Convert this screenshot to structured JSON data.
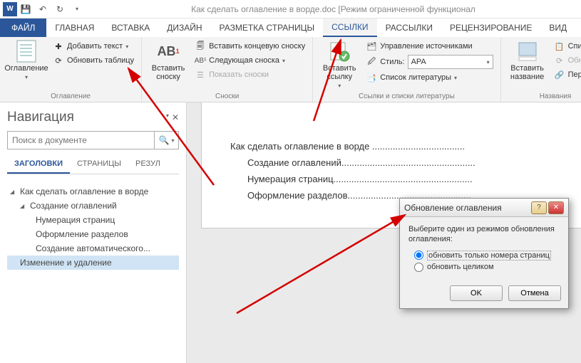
{
  "titlebar": {
    "title": "Как сделать оглавление в ворде.doc [Режим ограниченной функционал"
  },
  "tabs": {
    "file": "ФАЙЛ",
    "home": "ГЛАВНАЯ",
    "insert": "ВСТАВКА",
    "design": "ДИЗАЙН",
    "layout": "РАЗМЕТКА СТРАНИЦЫ",
    "refs": "ССЫЛКИ",
    "mail": "РАССЫЛКИ",
    "review": "РЕЦЕНЗИРОВАНИЕ",
    "view": "ВИД"
  },
  "ribbon": {
    "toc": {
      "btn": "Оглавление",
      "addText": "Добавить текст",
      "update": "Обновить таблицу",
      "group": "Оглавление"
    },
    "footnotes": {
      "insert": "Вставить\nсноску",
      "ab": "AB",
      "endnote": "Вставить концевую сноску",
      "next": "Следующая сноска",
      "show": "Показать сноски",
      "group": "Сноски"
    },
    "cit": {
      "insert": "Вставить\nссылку",
      "manage": "Управление источниками",
      "styleLabel": "Стиль:",
      "styleValue": "APA",
      "bib": "Список литературы",
      "group": "Ссылки и списки литературы"
    },
    "cap": {
      "insert": "Вставить\nназвание",
      "list": "Список и",
      "update": "Обновит",
      "cross": "Перекрес",
      "group": "Названия"
    }
  },
  "nav": {
    "title": "Навигация",
    "searchPlaceholder": "Поиск в документе",
    "tabs": {
      "headings": "ЗАГОЛОВКИ",
      "pages": "СТРАНИЦЫ",
      "results": "РЕЗУЛ"
    },
    "tree": {
      "root": "Как сделать оглавление в ворде",
      "n1": "Создание оглавлений",
      "n11": "Нумерация страниц",
      "n12": "Оформление разделов",
      "n13": "Создание автоматического...",
      "n2": "Изменение и удаление"
    }
  },
  "doc": {
    "l1": "Как сделать оглавление в ворде ....................................",
    "l2": "Создание оглавлений....................................................",
    "l3": "Нумерация страниц......................................................",
    "l4": "Оформление разделов................................................"
  },
  "dialog": {
    "title": "Обновление оглавления",
    "prompt": "Выберите один из режимов обновления оглавления:",
    "opt1": "обновить только номера страниц",
    "opt2": "обновить целиком",
    "ok": "OK",
    "cancel": "Отмена"
  }
}
